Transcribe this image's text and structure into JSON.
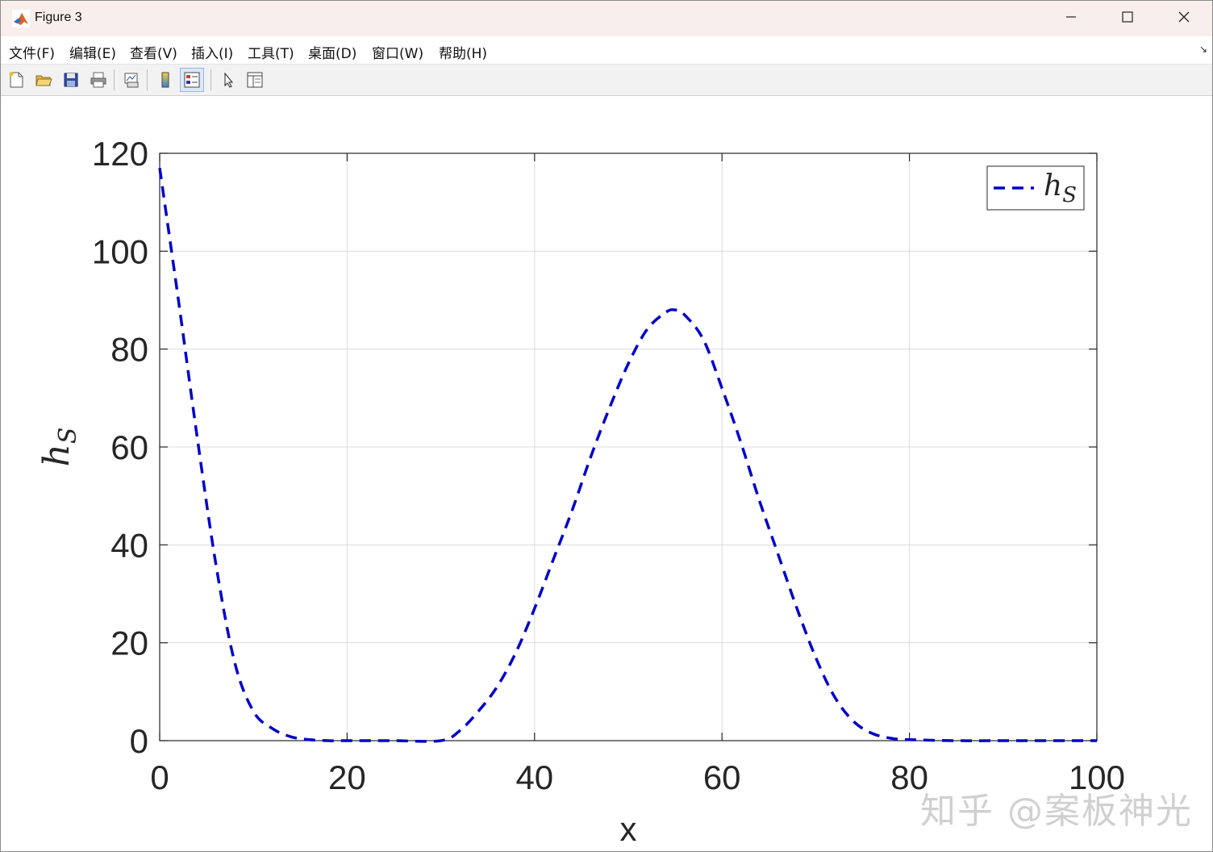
{
  "window": {
    "title": "Figure 3"
  },
  "menu": [
    "文件(F)",
    "编辑(E)",
    "查看(V)",
    "插入(I)",
    "工具(T)",
    "桌面(D)",
    "窗口(W)",
    "帮助(H)"
  ],
  "toolbar": {
    "icons": [
      "new-figure-icon",
      "open-file-icon",
      "save-icon",
      "print-icon",
      "link-plot-icon",
      "colorbar-icon",
      "legend-icon",
      "edit-plot-pointer-icon",
      "property-inspector-icon"
    ]
  },
  "watermark": "知乎 @案板神光",
  "chart_data": {
    "type": "line",
    "xlabel": "x",
    "ylabel": "h_S",
    "xlim": [
      0,
      100
    ],
    "ylim": [
      0,
      120
    ],
    "xticks": [
      "0",
      "20",
      "40",
      "60",
      "80",
      "100"
    ],
    "yticks": [
      "0",
      "20",
      "40",
      "60",
      "80",
      "100",
      "120"
    ],
    "grid": true,
    "legend": {
      "placement": "top-right",
      "entries": [
        "h_S"
      ]
    },
    "series": [
      {
        "name": "h_S",
        "color": "#0000cc",
        "style": "dashed",
        "x": [
          0,
          2,
          4,
          6,
          8,
          10,
          12,
          14,
          16,
          18,
          20,
          25,
          30,
          32,
          34,
          36,
          38,
          40,
          42,
          44,
          46,
          48,
          50,
          52,
          54,
          55,
          56,
          58,
          60,
          62,
          64,
          66,
          68,
          70,
          72,
          74,
          76,
          78,
          80,
          85,
          90,
          100
        ],
        "values": [
          117,
          90,
          62,
          36,
          16,
          6,
          2.5,
          0.8,
          0.2,
          0,
          0,
          0,
          0,
          2,
          6,
          11,
          18,
          27,
          37,
          47,
          58,
          68,
          77,
          84,
          87.5,
          88,
          87,
          82,
          72,
          61,
          49,
          38,
          27,
          17,
          9,
          4,
          1.5,
          0.5,
          0.2,
          0,
          0,
          0
        ]
      }
    ]
  }
}
